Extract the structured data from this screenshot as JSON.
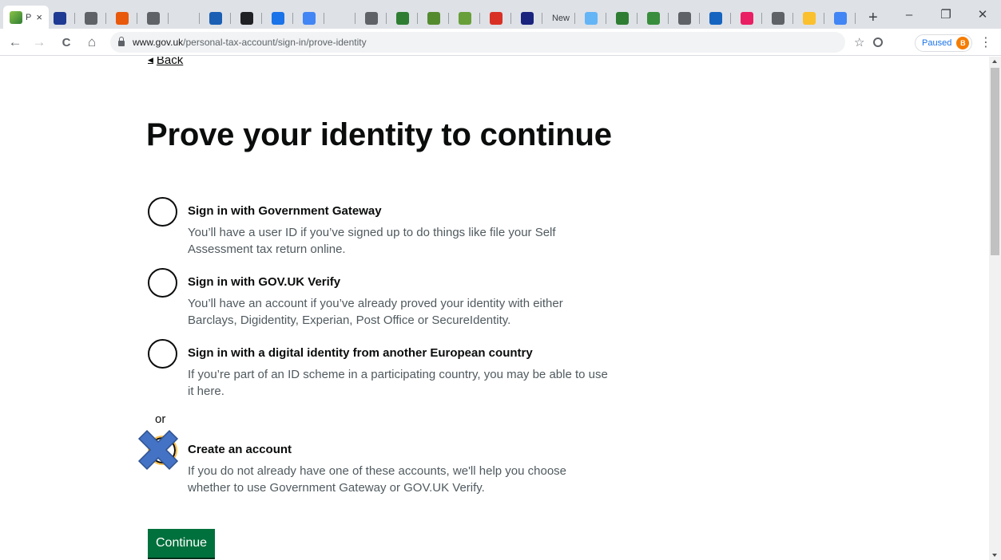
{
  "browser": {
    "active_tab": {
      "title": "P",
      "close": "×"
    },
    "tab_favicons": [
      {
        "icon": "generic-site-icon",
        "color": "#1f3a93"
      },
      {
        "icon": "globe-icon",
        "color": "#5f6368"
      },
      {
        "icon": "opera-icon",
        "color": "#e8590c"
      },
      {
        "icon": "globe-icon",
        "color": "#5f6368"
      },
      {
        "icon": "blank-icon",
        "color": "#dee1e6"
      },
      {
        "icon": "nws-icon",
        "color": "#1a5fb4"
      },
      {
        "icon": "bbc-icon",
        "color": "#202124"
      },
      {
        "icon": "play-icon",
        "color": "#1a73e8"
      },
      {
        "icon": "google-c-icon",
        "color": "#4285f4"
      },
      {
        "icon": "blank-icon",
        "color": "#dee1e6"
      },
      {
        "icon": "globe-icon",
        "color": "#5f6368"
      },
      {
        "icon": "heart-icon",
        "color": "#2e7d32"
      },
      {
        "icon": "heart-icon",
        "color": "#558b2f"
      },
      {
        "icon": "heart-icon",
        "color": "#689f38"
      },
      {
        "icon": "gmail-icon",
        "color": "#d93025"
      },
      {
        "icon": "mail-icon",
        "color": "#1a237e"
      },
      {
        "icon": "new-tab-icon",
        "color": "#5f6368"
      },
      {
        "icon": "card-icon",
        "color": "#64b5f6"
      },
      {
        "icon": "umbrella-icon",
        "color": "#2e7d32"
      },
      {
        "icon": "umbrella-icon",
        "color": "#388e3c"
      },
      {
        "icon": "globe-icon",
        "color": "#5f6368"
      },
      {
        "icon": "z-icon",
        "color": "#1565c0"
      },
      {
        "icon": "chart-icon",
        "color": "#e91e63"
      },
      {
        "icon": "globe-icon",
        "color": "#5f6368"
      },
      {
        "icon": "e-icon",
        "color": "#fbc02d"
      },
      {
        "icon": "google-g-icon",
        "color": "#4285f4"
      }
    ],
    "new_tab_label": "New",
    "new_tab_button": "+",
    "window_controls": {
      "minimize": "–",
      "restore": "❐",
      "close": "✕"
    },
    "nav": {
      "back": "←",
      "forward": "→",
      "reload": "C",
      "home": "⌂"
    },
    "url": {
      "host": "www.gov.uk",
      "path": "/personal-tax-account/sign-in/prove-identity"
    },
    "bookmark_star": "☆",
    "profile": {
      "label": "Paused",
      "initial": "B"
    },
    "menu": "⋮"
  },
  "page": {
    "back_link": "Back",
    "title": "Prove your identity to continue",
    "options": [
      {
        "label": "Sign in with Government Gateway",
        "hint": "You’ll have a user ID if you’ve signed up to do things like file your Self Assessment tax return online."
      },
      {
        "label": "Sign in with GOV.UK Verify",
        "hint": "You’ll have an account if you’ve already proved your identity with either Barclays, Digidentity, Experian, Post Office or SecureIdentity."
      },
      {
        "label": "Sign in with a digital identity from another European country",
        "hint": "If you’re part of an ID scheme in a participating country, you may be able to use it here."
      }
    ],
    "divider": "or",
    "create_option": {
      "label": "Create an account",
      "hint": "If you do not already have one of these accounts, we'll help you choose whether to use Government Gateway or GOV.UK Verify."
    },
    "continue_label": "Continue"
  },
  "colors": {
    "gov_text": "#0b0c0c",
    "gov_hint": "#505a5f",
    "gov_green": "#00703c",
    "cursor_marker": "#4472c4",
    "focus_ring": "#ffbf47"
  }
}
